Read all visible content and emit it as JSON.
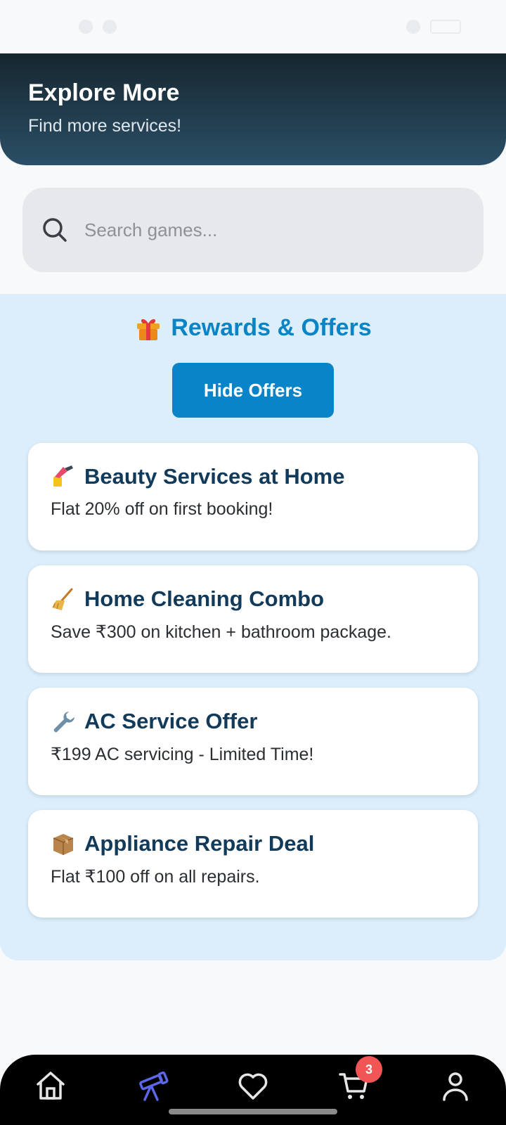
{
  "header": {
    "title": "Explore More",
    "subtitle": "Find more services!"
  },
  "search": {
    "placeholder": "Search games..."
  },
  "rewards": {
    "heading": "Rewards & Offers",
    "toggle_label": "Hide Offers",
    "offers": [
      {
        "icon": "nail-polish-icon",
        "title": "Beauty Services at Home",
        "description": "Flat 20% off on first booking!"
      },
      {
        "icon": "broom-icon",
        "title": "Home Cleaning Combo",
        "description": "Save ₹300 on kitchen + bathroom package."
      },
      {
        "icon": "wrench-icon",
        "title": "AC Service Offer",
        "description": "₹199 AC servicing - Limited Time!"
      },
      {
        "icon": "package-icon",
        "title": "Appliance Repair Deal",
        "description": "Flat ₹100 off on all repairs."
      }
    ]
  },
  "nav": {
    "items": [
      {
        "name": "home",
        "icon": "home-icon"
      },
      {
        "name": "explore",
        "icon": "telescope-icon",
        "active": true
      },
      {
        "name": "favorites",
        "icon": "heart-icon"
      },
      {
        "name": "cart",
        "icon": "cart-icon",
        "badge": "3"
      },
      {
        "name": "profile",
        "icon": "user-icon"
      }
    ]
  },
  "colors": {
    "accent": "#0a84c8",
    "header_gradient_top": "#16262f",
    "header_gradient_bottom": "#2b4f66",
    "rewards_bg": "#dceefb",
    "badge": "#f25555",
    "nav_active": "#5b67e8"
  }
}
